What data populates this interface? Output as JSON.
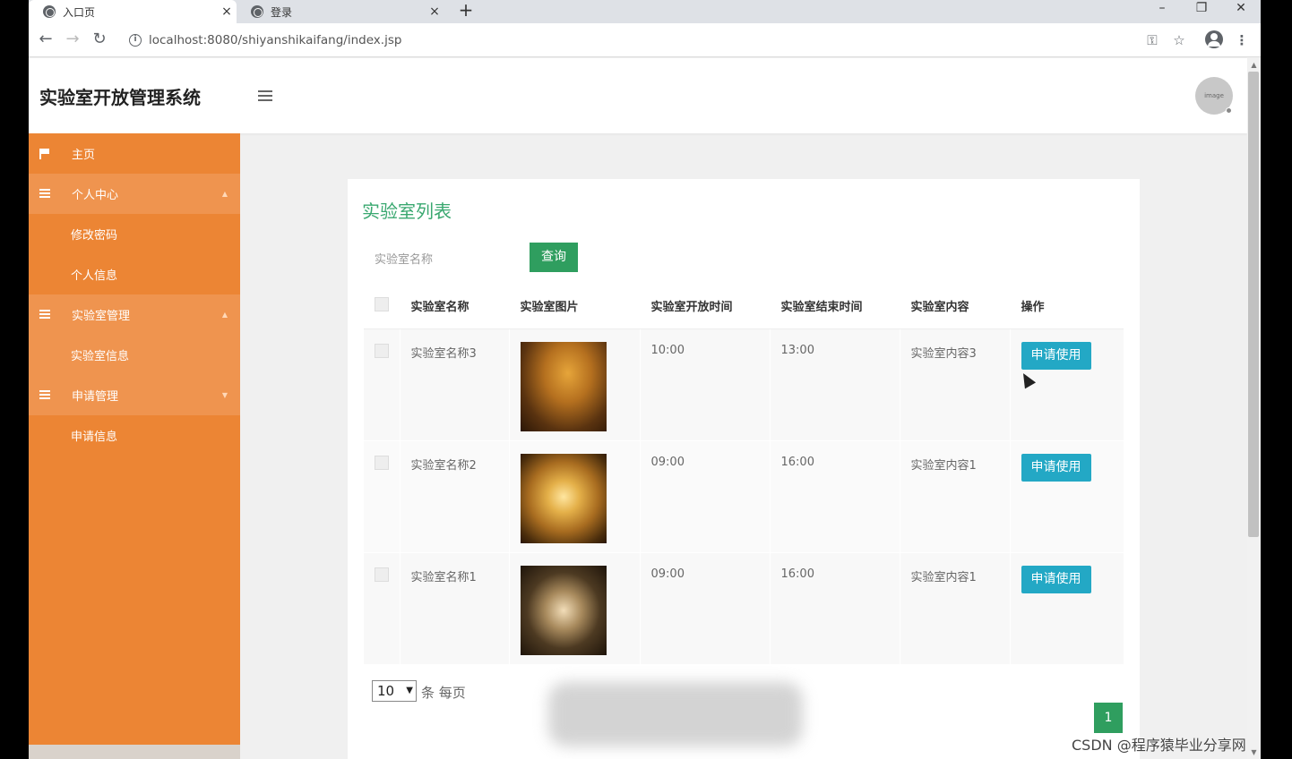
{
  "browser": {
    "tabs": [
      {
        "label": "入口页",
        "close": "×"
      },
      {
        "label": "登录",
        "close": "×"
      }
    ],
    "new_tab": "+",
    "window_controls": {
      "minimize": "–",
      "restore": "❐",
      "close": "✕"
    },
    "nav": {
      "back": "←",
      "forward": "→",
      "reload": "↻"
    },
    "url": "localhost:8080/shiyanshikaifang/index.jsp",
    "icons": [
      "key-icon",
      "star-icon",
      "profile-icon",
      "menu-dots-icon"
    ]
  },
  "header": {
    "title": "实验室开放管理系统",
    "avatar_text": "image"
  },
  "sidebar": {
    "items": [
      {
        "label": "主页",
        "type": "top",
        "icon": "flag-icon"
      },
      {
        "label": "个人中心",
        "type": "parent",
        "icon": "grid-icon",
        "caret": "▲"
      },
      {
        "label": "修改密码",
        "type": "sub"
      },
      {
        "label": "个人信息",
        "type": "sub"
      },
      {
        "label": "实验室管理",
        "type": "parent",
        "icon": "grid-icon",
        "caret": "▲"
      },
      {
        "label": "实验室信息",
        "type": "sub"
      },
      {
        "label": "申请管理",
        "type": "parent",
        "icon": "grid-icon",
        "caret": "▼"
      },
      {
        "label": "申请信息",
        "type": "sub"
      }
    ],
    "colors": {
      "bg": "#ec8534",
      "parent_bg": "#ef944f"
    }
  },
  "main": {
    "title": "实验室列表",
    "search": {
      "placeholder": "实验室名称",
      "button": "查询"
    },
    "table": {
      "columns": [
        "实验室名称",
        "实验室图片",
        "实验室开放时间",
        "实验室结束时间",
        "实验室内容",
        "操作"
      ],
      "rows": [
        {
          "name": "实验室名称3",
          "open": "10:00",
          "close": "13:00",
          "content": "实验室内容3",
          "action": "申请使用"
        },
        {
          "name": "实验室名称2",
          "open": "09:00",
          "close": "16:00",
          "content": "实验室内容1",
          "action": "申请使用"
        },
        {
          "name": "实验室名称1",
          "open": "09:00",
          "close": "16:00",
          "content": "实验室内容1",
          "action": "申请使用"
        }
      ]
    },
    "pagination": {
      "page_size": "10",
      "per_page_text": "条 每页",
      "current_page": "1"
    },
    "colors": {
      "title": "#3aa870",
      "query_button": "#2f9e5f",
      "apply_button": "#23a8c5"
    }
  },
  "watermark": "CSDN @程序猿毕业分享网"
}
